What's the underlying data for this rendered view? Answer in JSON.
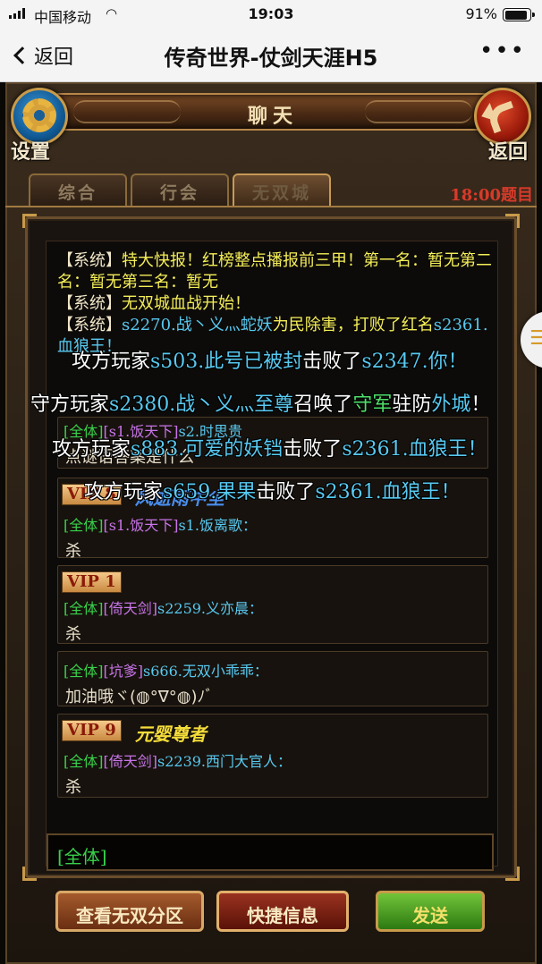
{
  "status_bar": {
    "carrier": "中国移动",
    "time": "19:03",
    "battery_percent": "91%",
    "battery_level": 0.91
  },
  "nav_bar": {
    "back_label": "返回",
    "title": "传奇世界-仗剑天涯H5",
    "more": "•••"
  },
  "game": {
    "panel_title": "聊天",
    "settings_label": "设置",
    "back_label": "返回",
    "tabs": [
      "综合",
      "行会",
      "无双城"
    ],
    "active_tab": "无双城",
    "marquee": "18:00题目",
    "system_messages": {
      "tag": "【系统】",
      "line1_text": "特大快报！红榜整点播报前三甲！第一名：暂无第二名：暂无第三名：暂无",
      "line2_text": "无双城血战开始！",
      "line3_prefix": "s2270.战丶义灬蛇妖",
      "line3_text": "为民除害，打败了红名",
      "line3_target": "s2361.血狼王！"
    },
    "messages": [
      {
        "vip": "VIP 8",
        "vip_title": "风逝雨中尘",
        "channel": "[全体]",
        "guild": "[s1.饭天下]",
        "sender": "s1.饭离歌：",
        "text": "杀"
      },
      {
        "vip": "VIP 1",
        "vip_title": "",
        "channel": "[全体]",
        "guild": "[倚天剑]",
        "sender": "s2259.义亦晨：",
        "text": "杀"
      },
      {
        "vip": "",
        "vip_title": "",
        "channel": "[全体]",
        "guild": "[坑爹]",
        "sender": "s666.无双小乖乖：",
        "text": "加油哦ヾ(◍°∇°◍)ﾉﾞ"
      },
      {
        "vip": "VIP 9",
        "vip_title": "元婴尊者",
        "channel": "[全体]",
        "guild": "[倚天剑]",
        "sender": "s2239.西门大官人：",
        "text": "杀"
      }
    ],
    "partial_message": {
      "channel": "[全体]",
      "guild": "[s1.饭天下]",
      "sender": "s2.时思贵",
      "text": "点谜语答案是什么"
    },
    "broadcasts": [
      {
        "a": "攻方玩家",
        "b": "s503.此号已被封",
        "c": "击败了",
        "d": "s2347.你！"
      },
      {
        "a": "守方玩家",
        "b": "s2380.战丶义灬至尊",
        "c": "召唤了",
        "d": "守军",
        "e": "驻防",
        "f": "外城",
        "g": "！"
      },
      {
        "a": "攻方玩家",
        "b": "s883.可爱的妖铛",
        "c": "击败了",
        "d": "s2361.血狼王！"
      },
      {
        "a": "攻方玩家",
        "b": "s659.果果",
        "c": "击败了",
        "d": "s2361.血狼王！"
      }
    ],
    "input_prefix": "[全体]",
    "buttons": {
      "zone": "查看无双分区",
      "quick": "快捷信息",
      "send": "发送"
    }
  },
  "colors": {
    "system_text": "#f0e6c8",
    "yellow_name": "#f4ee58",
    "cyan_name": "#58c9f0",
    "channel_green": "#38d04a",
    "guild_purple": "#c774e8",
    "marquee_red": "#d83a2a"
  }
}
